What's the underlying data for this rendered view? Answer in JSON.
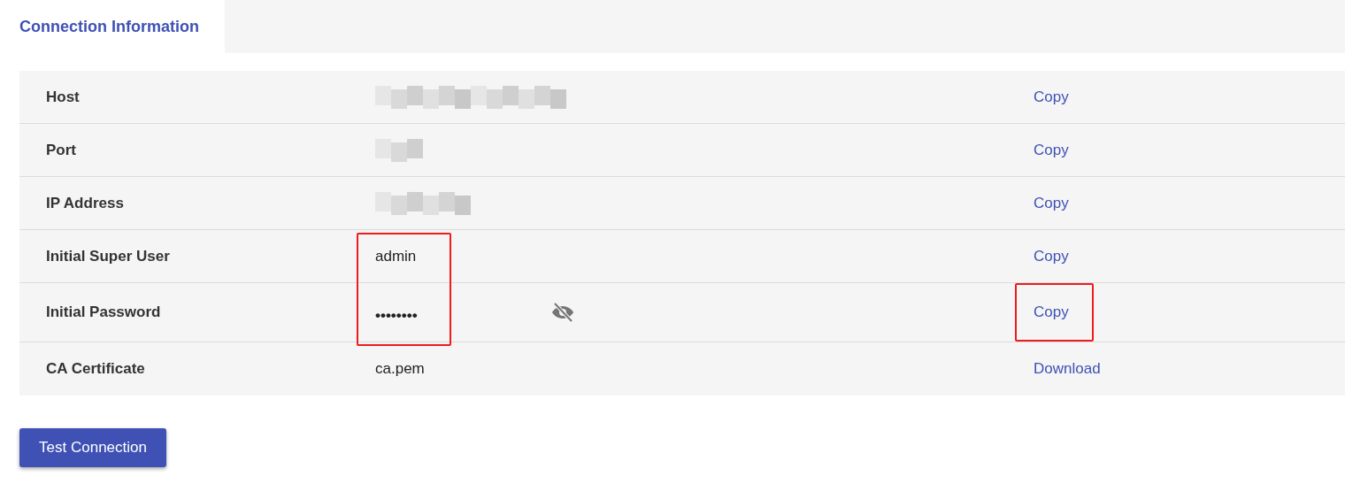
{
  "tabs": [
    {
      "label": "Connection Information",
      "selected": true
    }
  ],
  "rows": [
    {
      "label": "Host",
      "redacted": true,
      "action": "Copy",
      "value_highlighted": false,
      "action_highlighted": false
    },
    {
      "label": "Port",
      "redacted": true,
      "action": "Copy",
      "value_highlighted": false,
      "action_highlighted": false
    },
    {
      "label": "IP Address",
      "redacted": true,
      "action": "Copy",
      "value_highlighted": false,
      "action_highlighted": false
    },
    {
      "label": "Initial Super User",
      "value": "admin",
      "action": "Copy",
      "value_highlighted": true,
      "action_highlighted": false
    },
    {
      "label": "Initial Password",
      "value": "••••••••",
      "masked": true,
      "action": "Copy",
      "value_highlighted": true,
      "action_highlighted": true
    },
    {
      "label": "CA Certificate",
      "value": "ca.pem",
      "action": "Download",
      "value_highlighted": false,
      "action_highlighted": false
    }
  ],
  "button": {
    "label": "Test Connection"
  }
}
